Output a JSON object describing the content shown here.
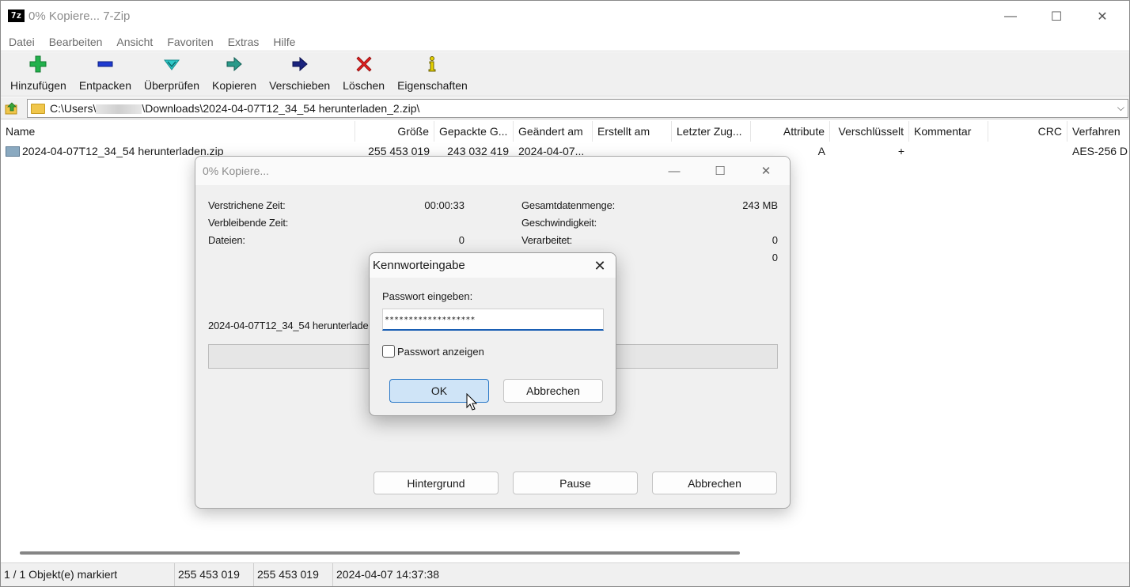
{
  "window": {
    "title": "0% Kopiere... 7-Zip",
    "app_icon_text": "7z",
    "minimize": "—",
    "maximize": "☐",
    "close": "✕"
  },
  "menu": [
    "Datei",
    "Bearbeiten",
    "Ansicht",
    "Favoriten",
    "Extras",
    "Hilfe"
  ],
  "toolbar": [
    {
      "label": "Hinzufügen",
      "icon": "plus-icon",
      "color": "#22b14c"
    },
    {
      "label": "Entpacken",
      "icon": "minus-icon",
      "color": "#1f3bd1"
    },
    {
      "label": "Überprüfen",
      "icon": "check-icon",
      "color": "#2ec8c8"
    },
    {
      "label": "Kopieren",
      "icon": "copy-arrow-icon",
      "color": "#2a9a8a"
    },
    {
      "label": "Verschieben",
      "icon": "move-arrow-icon",
      "color": "#1a237e"
    },
    {
      "label": "Löschen",
      "icon": "delete-icon",
      "color": "#e02020"
    },
    {
      "label": "Eigenschaften",
      "icon": "info-icon",
      "color": "#e5d100"
    }
  ],
  "address": {
    "prefix": "C:\\Users\\",
    "suffix": "\\Downloads\\2024-04-07T12_34_54 herunterladen_2.zip\\",
    "dropdown": "⌵"
  },
  "columns": [
    "Name",
    "Größe",
    "Gepackte G...",
    "Geändert am",
    "Erstellt am",
    "Letzter Zug...",
    "Attribute",
    "Verschlüsselt",
    "Kommentar",
    "CRC",
    "Verfahren"
  ],
  "rows": [
    {
      "name": "2024-04-07T12_34_54 herunterladen.zip",
      "size": "255 453 019",
      "packed": "243 032 419",
      "modified": "2024-04-07...",
      "created": "",
      "accessed": "",
      "attributes": "A",
      "encrypted": "+",
      "comment": "",
      "crc": "",
      "method": "AES-256 D"
    }
  ],
  "status": {
    "selected": "1 / 1 Objekt(e) markiert",
    "size": "255 453 019",
    "packed": "255 453 019",
    "date": "2024-04-07 14:37:38"
  },
  "progress_dialog": {
    "title": "0% Kopiere...",
    "elapsed_label": "Verstrichene Zeit:",
    "elapsed_value": "00:00:33",
    "remaining_label": "Verbleibende Zeit:",
    "files_label": "Dateien:",
    "files_value": "0",
    "total_label": "Gesamtdatenmenge:",
    "total_value": "243 MB",
    "speed_label": "Geschwindigkeit:",
    "processed_label": "Verarbeitet:",
    "processed_value": "0",
    "extra_value": "0",
    "current_file": "2024-04-07T12_34_54 herunterladen",
    "progress_percent": 0,
    "btn_background": "Hintergrund",
    "btn_pause": "Pause",
    "btn_cancel": "Abbrechen"
  },
  "password_dialog": {
    "title": "Kennworteingabe",
    "close": "✕",
    "prompt": "Passwort eingeben:",
    "value": "*******************",
    "show_label": "Passwort anzeigen",
    "show_checked": false,
    "ok": "OK",
    "cancel": "Abbrechen"
  }
}
